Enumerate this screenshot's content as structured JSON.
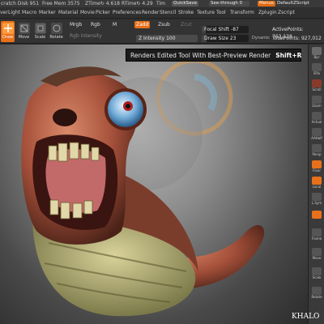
{
  "status_bar": {
    "items": [
      "cratch Disk 951",
      "Free Mem 3575",
      "ZTime↻ 4.618",
      "RTime↻ 4.29",
      "Tim"
    ],
    "quicksave": "QuickSave",
    "see_through": "See-through",
    "see_through_value": "0",
    "menus": "Menus",
    "default_zscript": "DefaultZScript"
  },
  "menu_bar": {
    "items": [
      "ver",
      "Light",
      "Macro",
      "Marker",
      "Material",
      "Movie",
      "Picker",
      "Preferences",
      "Render",
      "Stencil",
      "Stroke",
      "Texture",
      "Tool",
      "Transform",
      "Zplugin",
      "Zscript"
    ]
  },
  "toolbar": {
    "draw": "Draw",
    "move": "Move",
    "scale": "Scale",
    "rotate": "Rotate",
    "mrgb": "Mrgb",
    "rgb": "Rgb",
    "m": "M",
    "rgb_intensity": "Rgb Intensity",
    "zadd": "Zadd",
    "zsub": "Zsub",
    "zcut": "Zcut",
    "z_intensity_label": "Z Intensity",
    "z_intensity_value": "100",
    "focal_shift_label": "Focal Shift",
    "focal_shift_value": "-87",
    "draw_size_label": "Draw Size",
    "draw_size_value": "23",
    "dynamic": "Dynamic",
    "active_points_label": "ActivePoints:",
    "active_points_value": "763,138",
    "total_points_label": "TotalPoints:",
    "total_points_value": "927,012"
  },
  "tooltip": {
    "text": "Renders Edited Tool With Best-Preview Render",
    "shortcut": "Shift+R"
  },
  "right_shelf": {
    "items": [
      "Bpr",
      "SPix",
      "Scroll",
      "Zoom",
      "Actual",
      "AAHalf",
      "Persp",
      "Floor",
      "Local",
      "L.Sym",
      "Frame",
      "Move",
      "Scale",
      "Rotate"
    ]
  },
  "watermark": "KHALO",
  "colors": {
    "accent_orange": "#e8701a",
    "status_orange": "#e06a10",
    "panel": "#333333"
  }
}
